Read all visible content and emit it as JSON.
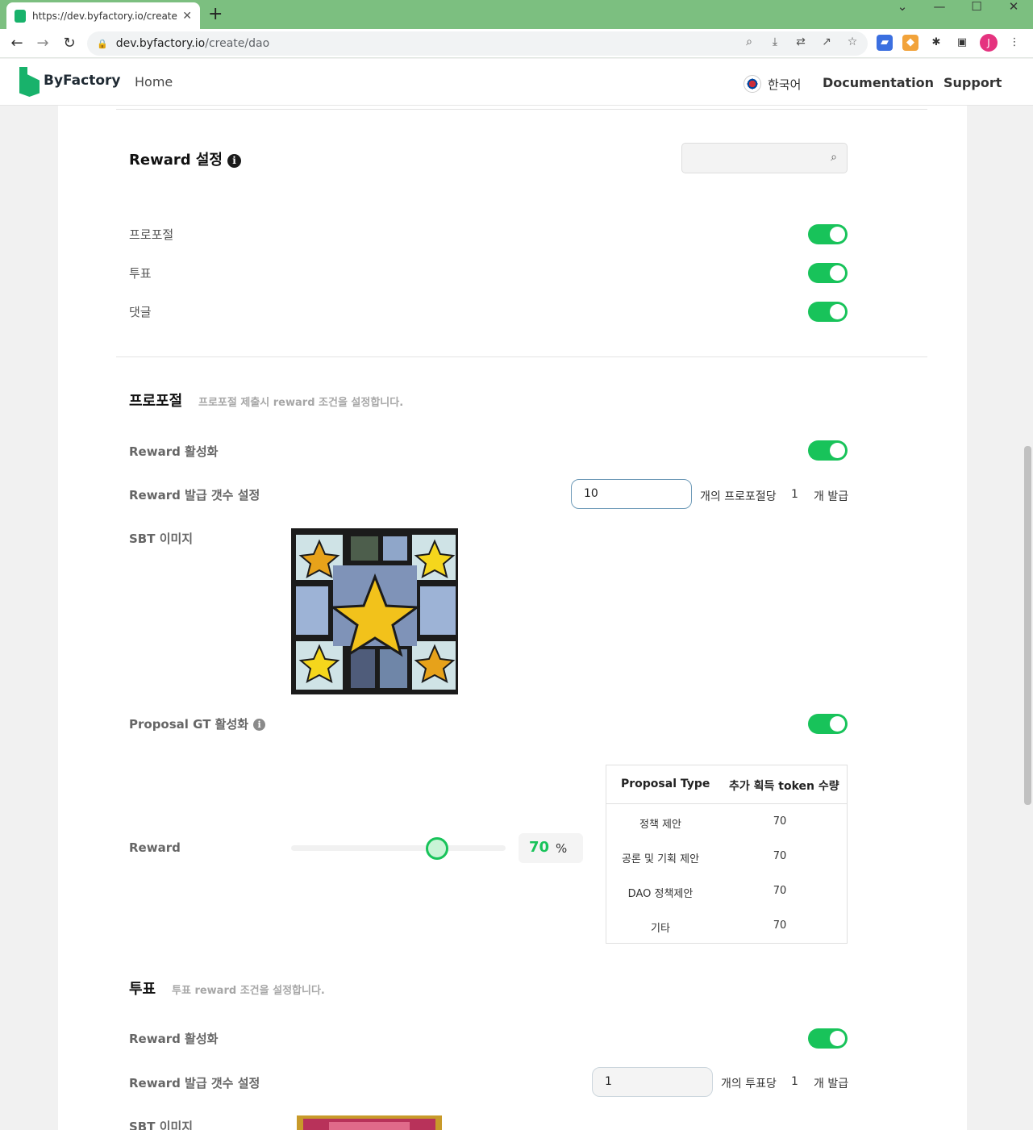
{
  "browser": {
    "tab_title": "https://dev.byfactory.io/create/d",
    "url_host": "dev.byfactory.io",
    "url_path": "/create/dao",
    "avatar_initial": "J"
  },
  "site": {
    "logo": "ByFactory",
    "nav_home": "Home",
    "language": "한국어",
    "nav_documentation": "Documentation",
    "nav_support": "Support"
  },
  "reward_settings": {
    "title": "Reward 설정",
    "toggles": [
      {
        "label": "프로포절",
        "on": true
      },
      {
        "label": "투표",
        "on": true
      },
      {
        "label": "댓글",
        "on": true
      }
    ]
  },
  "proposal_section": {
    "title": "프로포절",
    "desc": "프로포절 제출시 reward 조건을 설정합니다.",
    "reward_active_label": "Reward 활성화",
    "reward_active": true,
    "issue_count_label": "Reward 발급 갯수 설정",
    "issue_count_value": "10",
    "per_text": "개의 프로포절당",
    "issue_amount": "1",
    "issue_unit": "개 발급",
    "sbt_label": "SBT 이미지",
    "gt_label": "Proposal GT 활성화",
    "gt_active": true,
    "reward_label": "Reward",
    "reward_percent": 70,
    "reward_percent_text": "70",
    "percent_unit": "%",
    "table": {
      "headers": [
        "Proposal Type",
        "추가 획득 token 수량"
      ],
      "rows": [
        [
          "정책 제안",
          "70"
        ],
        [
          "공론 및 기획 제안",
          "70"
        ],
        [
          "DAO 정책제안",
          "70"
        ],
        [
          "기타",
          "70"
        ]
      ]
    }
  },
  "vote_section": {
    "title": "투표",
    "desc": "투표 reward 조건을 설정합니다.",
    "reward_active_label": "Reward 활성화",
    "reward_active": true,
    "issue_count_label": "Reward 발급 갯수 설정",
    "issue_count_value": "1",
    "per_text": "개의 투표당",
    "issue_amount": "1",
    "issue_unit": "개 발급",
    "sbt_label": "SBT 이미지"
  },
  "colors": {
    "accent_green": "#18c35a",
    "brand_green": "#18b26b",
    "tab_bar": "#7cbf80"
  }
}
